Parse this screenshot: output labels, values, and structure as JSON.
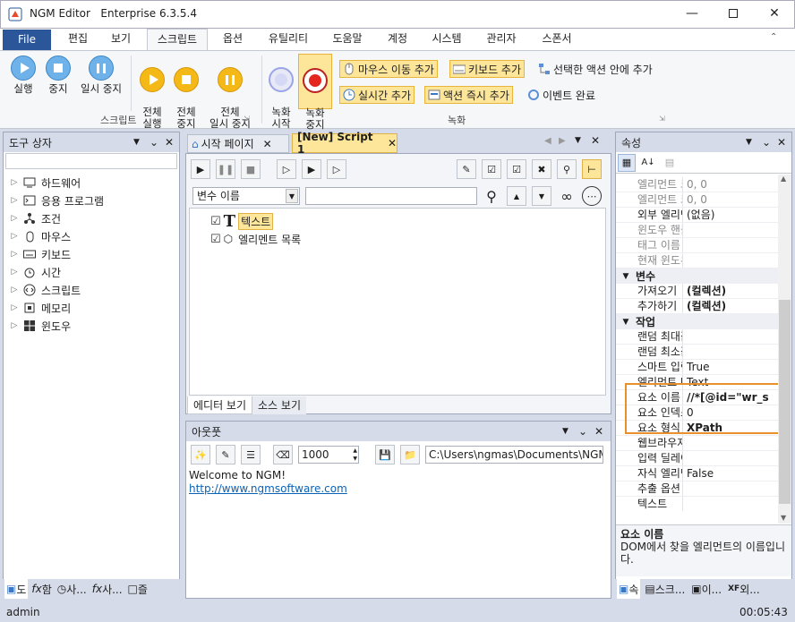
{
  "window": {
    "app_name": "NGM Editor",
    "edition": "Enterprise 6.3.5.4"
  },
  "menu": {
    "file": "File",
    "tabs": [
      "편집",
      "보기",
      "스크립트",
      "옵션",
      "유틸리티",
      "도움말",
      "계정",
      "시스템",
      "관리자",
      "스폰서"
    ]
  },
  "ribbon": {
    "run": "실행",
    "stop": "중지",
    "pause": "일시 중지",
    "run_all": "전체\n실행",
    "stop_all": "전체\n중지",
    "pause_all": "전체\n일시 중지",
    "script_group": "스크립트",
    "rec_start": "녹화\n시작",
    "rec_stop": "녹화\n중지",
    "add_mouse_move": "마우스 이동 추가",
    "add_keyboard": "키보드 추가",
    "add_in_action": "선택한 액션 안에 추가",
    "add_realtime": "실시간 추가",
    "add_action_now": "액션 즉시 추가",
    "event_done": "이벤트 완료",
    "record_group": "녹화"
  },
  "toolbox": {
    "title": "도구 상자",
    "items": [
      "하드웨어",
      "응용 프로그램",
      "조건",
      "마우스",
      "키보드",
      "시간",
      "스크립트",
      "메모리",
      "윈도우"
    ],
    "bottom_tabs": [
      "도",
      "함",
      "사...",
      "사...",
      "즐"
    ]
  },
  "editor": {
    "tabs": [
      "시작 페이지",
      "[New] Script 1"
    ],
    "variable_select": "변수 이름",
    "tree": [
      {
        "label": "텍스트",
        "checked": true
      },
      {
        "label": "엘리멘트 목록",
        "checked": true
      }
    ],
    "view_tabs": [
      "에디터 보기",
      "소스 보기"
    ]
  },
  "output": {
    "title": "아웃풋",
    "count": "1000",
    "path": "C:\\Users\\ngmas\\Documents\\NGM6\\",
    "welcome": "Welcome to NGM!",
    "link": "http://www.ngmsoftware.com"
  },
  "properties": {
    "title": "속성",
    "rows_top": [
      {
        "name": "엘리먼트 크",
        "value": "0, 0"
      },
      {
        "name": "엘리먼트 크",
        "value": "0, 0"
      },
      {
        "name": "외부 엘리먼",
        "value": "(없음)"
      },
      {
        "name": "윈도우 핸들",
        "value": ""
      },
      {
        "name": "태그 이름",
        "value": ""
      },
      {
        "name": "현재 윈도우",
        "value": ""
      }
    ],
    "cat_variable": "변수",
    "rows_var": [
      {
        "name": "가져오기",
        "value": "(컬렉션)"
      },
      {
        "name": "추가하기",
        "value": "(컬렉션)"
      }
    ],
    "cat_work": "작업",
    "rows_work": [
      {
        "name": "랜덤 최대값",
        "value": ""
      },
      {
        "name": "랜덤 최소값",
        "value": ""
      },
      {
        "name": "스마트 입력",
        "value": "True"
      },
      {
        "name": "엘리먼트 타",
        "value": "Text"
      },
      {
        "name": "요소 이름",
        "value": "//*[@id=\"wr_s"
      },
      {
        "name": "요소 인덱스",
        "value": "0"
      },
      {
        "name": "요소 형식",
        "value": "XPath"
      },
      {
        "name": "웹브라우저",
        "value": ""
      },
      {
        "name": "입력 딜레이",
        "value": ""
      },
      {
        "name": "자식 엘리먼",
        "value": "False"
      },
      {
        "name": "추출 옵션",
        "value": ""
      },
      {
        "name": "텍스트",
        "value": ""
      }
    ],
    "desc_title": "요소 이름",
    "desc_text": "DOM에서 찾을 엘리먼트의 이름입니다.",
    "bottom_tabs": [
      "속",
      "스크...",
      "이...",
      "외..."
    ]
  },
  "status": {
    "user": "admin",
    "time": "00:05:43"
  },
  "colors": {
    "accent": "#2b579a",
    "highlight": "#e8902a",
    "link": "#0b62b4"
  }
}
